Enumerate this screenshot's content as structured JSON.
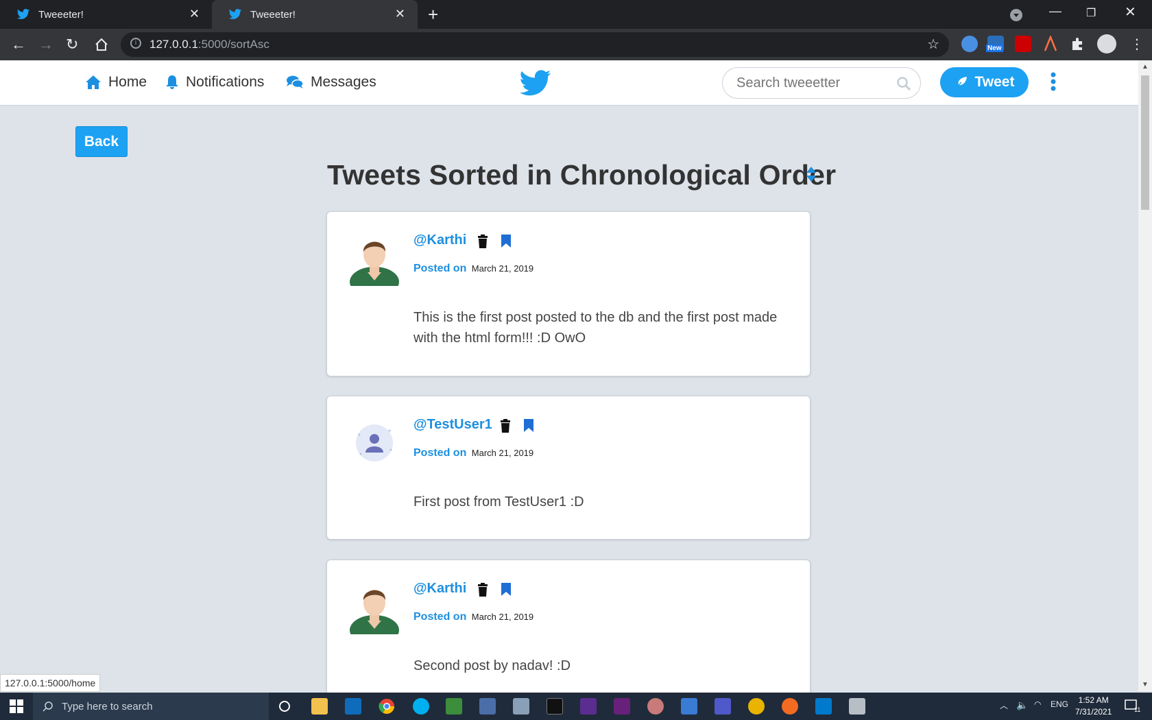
{
  "browser": {
    "tabs": [
      {
        "title": "Tweeeter!"
      },
      {
        "title": "Tweeeter!"
      }
    ],
    "url_host": "127.0.0.1",
    "url_rest": ":5000/sortAsc",
    "status_url": "127.0.0.1:5000/home",
    "extension_badge": "New"
  },
  "navbar": {
    "home": "Home",
    "notifications": "Notifications",
    "messages": "Messages",
    "search_placeholder": "Search tweeetter",
    "tweet_button": "Tweet"
  },
  "page": {
    "back": "Back",
    "title": "Tweets Sorted in Chronological Order"
  },
  "tweets": [
    {
      "user": "@Karthi",
      "posted_label": "Posted on",
      "date": "March 21, 2019",
      "text": "This is the first post posted to the db and the first post made with the html form!!! :D OwO"
    },
    {
      "user": "@TestUser1",
      "posted_label": "Posted on",
      "date": "March 21, 2019",
      "text": "First post from TestUser1 :D"
    },
    {
      "user": "@Karthi",
      "posted_label": "Posted on",
      "date": "March 21, 2019",
      "text": "Second post by nadav! :D"
    }
  ],
  "taskbar": {
    "search_placeholder": "Type here to search",
    "lang": "ENG",
    "time": "1:52 AM",
    "date": "7/31/2021",
    "notif_count": "11"
  },
  "colors": {
    "brand": "#1da1f2",
    "page_bg": "#dee3ea"
  }
}
